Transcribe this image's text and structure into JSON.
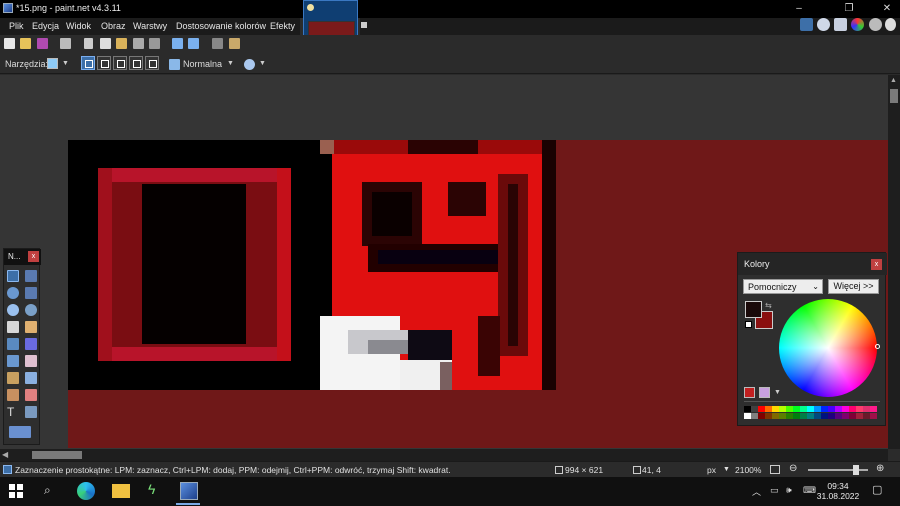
{
  "window": {
    "title": "*15.png - paint.net v4.3.11"
  },
  "menu": {
    "items": [
      "Plik",
      "Edycja",
      "Widok",
      "Obraz",
      "Warstwy",
      "Dostosowanie kolorów",
      "Efekty"
    ]
  },
  "toolbar2": {
    "tool_label": "Narzędzia:",
    "blend_mode": "Normalna"
  },
  "tools_panel": {
    "title": "N...",
    "close": "x"
  },
  "colors_panel": {
    "title": "Kolory",
    "close": "x",
    "mode_selected": "Pomocniczy",
    "more_button": "Więcej >>",
    "primary_color": "#1a0a0a",
    "secondary_color": "#8a1010"
  },
  "status": {
    "hint": "Zaznaczenie prostokątne: LPM: zaznacz, Ctrl+LPM: dodaj, PPM: odejmij, Ctrl+PPM: odwróć, trzymaj Shift: kwadrat.",
    "image_size": "994 × 621",
    "cursor_pos": "41, 4",
    "unit": "px",
    "zoom": "2100%"
  },
  "taskbar": {
    "time": "09:34",
    "date": "31.08.2022"
  },
  "icons": {
    "window_minimize": "minimize-icon",
    "window_maximize": "maximize-icon",
    "window_close": "close-icon"
  },
  "colors": {
    "canvas_bg": "#6f1818",
    "accent": "#3d6fa8"
  }
}
